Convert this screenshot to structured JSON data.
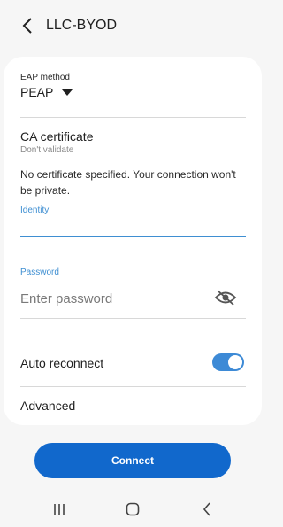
{
  "header": {
    "title": "LLC-BYOD"
  },
  "eap": {
    "label": "EAP method",
    "value": "PEAP"
  },
  "ca": {
    "title": "CA certificate",
    "subtitle": "Don't validate"
  },
  "warning": "No certificate specified. Your connection won't be private.",
  "identity": {
    "label": "Identity",
    "value": ""
  },
  "password": {
    "label": "Password",
    "placeholder": "Enter password"
  },
  "auto_reconnect": {
    "label": "Auto reconnect",
    "enabled": true
  },
  "advanced": {
    "label": "Advanced"
  },
  "connect": {
    "label": "Connect"
  },
  "colors": {
    "accent": "#3f8fd2",
    "button": "#1168cc",
    "toggle": "#3d8ad6"
  },
  "icons": {
    "back": "chevron-left-icon",
    "eye": "eye-slash-icon",
    "recents": "recent-apps-icon",
    "home": "home-icon",
    "nav_back": "back-icon"
  }
}
